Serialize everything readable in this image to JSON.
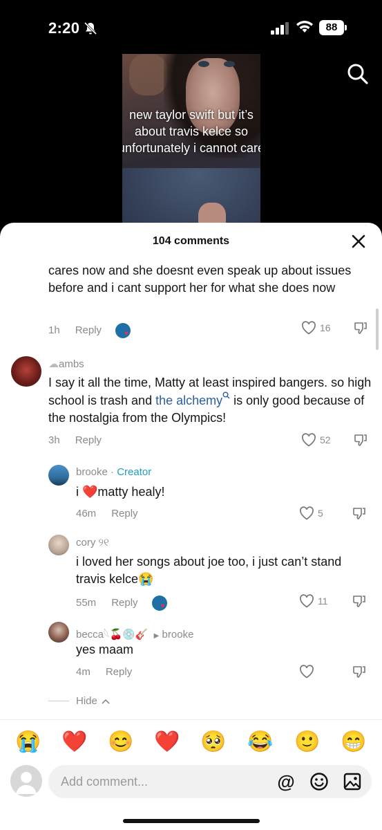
{
  "status_bar": {
    "time": "2:20",
    "battery": "88"
  },
  "video": {
    "caption": "new taylor swift but it’s about travis kelce so unfortunately i cannot care"
  },
  "sheet": {
    "title": "104 comments"
  },
  "comments": {
    "c0": {
      "text": "cares now and she doesnt even speak up about issues before and i cant support her for what she does now",
      "time": "1h",
      "reply": "Reply",
      "likes": "16"
    },
    "c1": {
      "username": "ambs",
      "text_before": "I say it all the time, Matty at least inspired bangers. so high school is trash and ",
      "link": "the alchemy",
      "text_after": " is only good because of the nostalgia from the Olympics!",
      "time": "3h",
      "reply": "Reply",
      "likes": "52"
    },
    "c2": {
      "username": "brooke",
      "separator": "·",
      "creator": "Creator",
      "text_before": "i ",
      "heart": "❤️",
      "text_after": "matty healy!",
      "time": "46m",
      "reply": "Reply",
      "likes": "5"
    },
    "c3": {
      "username": "cory ୨୧",
      "text": "i loved her songs about joe too, i just can’t stand travis kelce😭",
      "time": "55m",
      "reply": "Reply",
      "likes": "11"
    },
    "c4": {
      "username": "becca",
      "username_emojis": "𓆩🍒💿🎸",
      "reply_to": "brooke",
      "text": "yes maam",
      "time": "4m",
      "reply": "Reply"
    }
  },
  "hide_label": "Hide",
  "emoji_bar": [
    "😭",
    "❤️",
    "😊",
    "❤️",
    "🥺",
    "😂",
    "🙂",
    "😁"
  ],
  "input": {
    "placeholder": "Add comment...",
    "at": "@"
  },
  "colors": {
    "accent_creator": "#1a9fc6",
    "link": "#2a5f9e",
    "heart": "#f02d55"
  }
}
